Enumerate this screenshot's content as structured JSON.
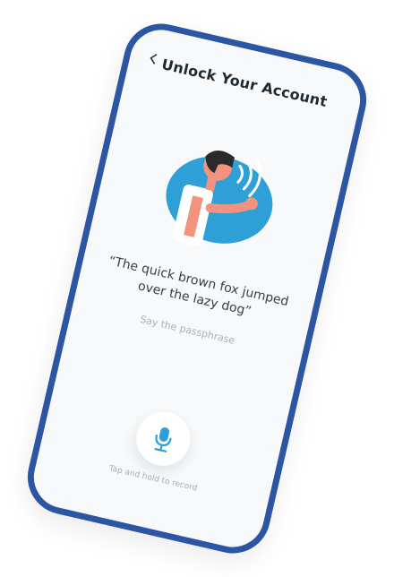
{
  "header": {
    "back_icon": "chevron-left-icon",
    "title": "Unlock Your Account"
  },
  "illustration": {
    "description_icon": "person-speaking-illustration",
    "colors": {
      "background": "#2f9fd8",
      "skin": "#f2937f",
      "hair": "#2b2a2a",
      "shirt": "#ffffff"
    }
  },
  "passphrase": {
    "text": "“The quick brown fox jumped over the lazy dog”",
    "hint": "Say the passphrase"
  },
  "record": {
    "icon": "microphone-icon",
    "label": "Tap and hold to record",
    "accent": "#2f9fd8"
  },
  "device": {
    "frame_color": "#2c55a4"
  }
}
